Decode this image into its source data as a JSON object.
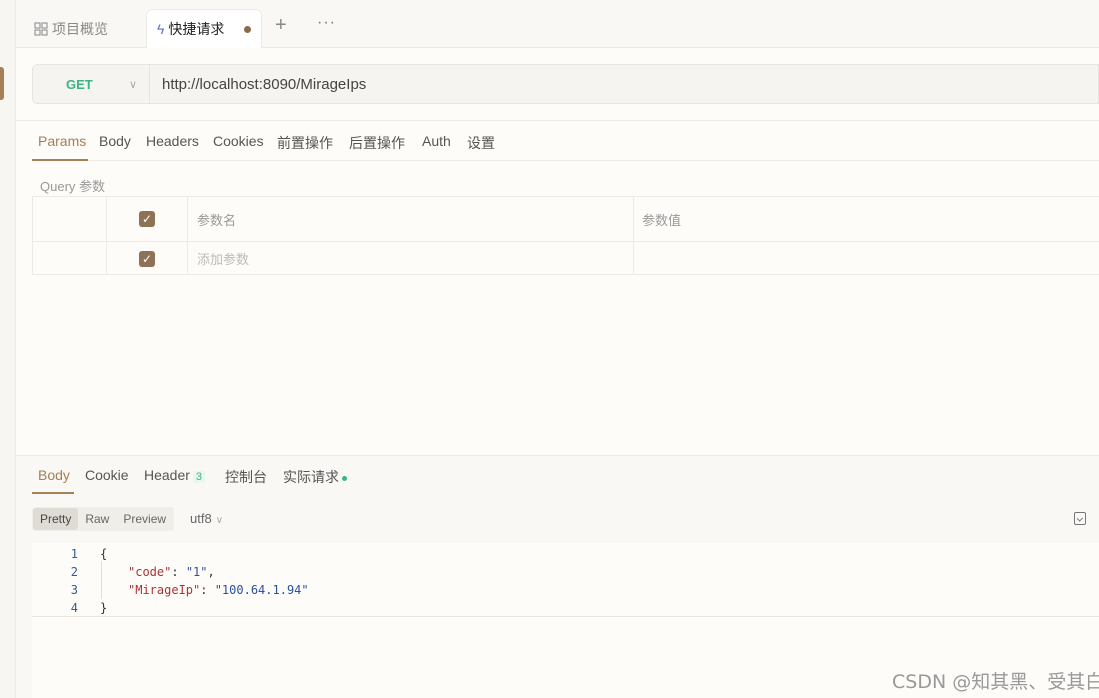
{
  "tabbar": {
    "overview_label": "项目概览",
    "quick_label": "快捷请求",
    "add_label": "+",
    "more_label": "···"
  },
  "request": {
    "method": "GET",
    "url": "http://localhost:8090/MirageIps"
  },
  "request_tabs": [
    "Params",
    "Body",
    "Headers",
    "Cookies",
    "前置操作",
    "后置操作",
    "Auth",
    "设置"
  ],
  "params": {
    "section_label": "Query 参数",
    "header_name": "参数名",
    "header_value": "参数值",
    "add_placeholder": "添加参数"
  },
  "response_tabs": {
    "body": "Body",
    "cookie": "Cookie",
    "header": "Header",
    "header_count": "3",
    "console": "控制台",
    "actual": "实际请求"
  },
  "view_modes": [
    "Pretty",
    "Raw",
    "Preview"
  ],
  "encoding": "utf8",
  "code_lines": [
    {
      "num": "1",
      "text": "{"
    },
    {
      "num": "2",
      "key": "\"code\"",
      "sep": ": ",
      "val": "\"1\"",
      "end": ","
    },
    {
      "num": "3",
      "key": "\"MirageIp\"",
      "sep": ": ",
      "val": "\"100.64.1.94\"",
      "end": ""
    },
    {
      "num": "4",
      "text": "}"
    }
  ],
  "watermark": "CSDN @知其黑、受其白",
  "colors": {
    "accent": "#a57f56",
    "method_get": "#3bb583",
    "checkbox": "#8e7255"
  }
}
